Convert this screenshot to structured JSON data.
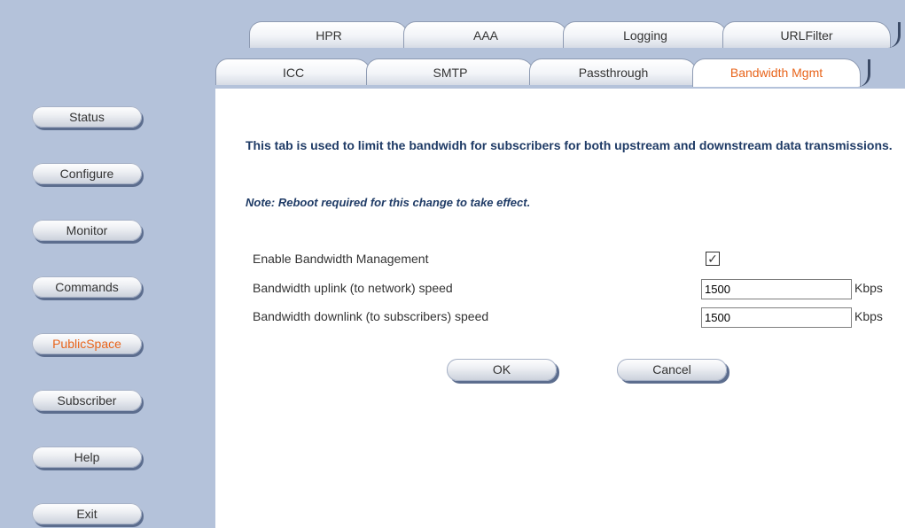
{
  "sidebar": {
    "items": [
      {
        "label": "Status"
      },
      {
        "label": "Configure"
      },
      {
        "label": "Monitor"
      },
      {
        "label": "Commands"
      },
      {
        "label": "PublicSpace"
      },
      {
        "label": "Subscriber"
      },
      {
        "label": "Help"
      },
      {
        "label": "Exit"
      }
    ],
    "active": "PublicSpace"
  },
  "tabs": {
    "row1": [
      {
        "label": "HPR"
      },
      {
        "label": "AAA"
      },
      {
        "label": "Logging"
      },
      {
        "label": "URLFilter"
      }
    ],
    "row2": [
      {
        "label": "ICC"
      },
      {
        "label": "SMTP"
      },
      {
        "label": "Passthrough"
      },
      {
        "label": "Bandwidth Mgmt"
      }
    ],
    "selected": "Bandwidth Mgmt"
  },
  "content": {
    "description": "This tab is used to limit the bandwidh for subscribers for both upstream and downstream data transmissions.",
    "note": "Note: Reboot required for this change to take effect.",
    "fields": {
      "enable": {
        "label": "Enable Bandwidth Management",
        "checked": true,
        "check_glyph": "✓"
      },
      "uplink": {
        "label": "Bandwidth uplink (to network) speed",
        "value": "1500",
        "unit": "Kbps"
      },
      "downlink": {
        "label": "Bandwidth downlink (to subscribers) speed",
        "value": "1500",
        "unit": "Kbps"
      }
    },
    "buttons": {
      "ok": "OK",
      "cancel": "Cancel"
    }
  },
  "colors": {
    "sidebar_bg": "#b4c2da",
    "accent": "#e8641b",
    "heading_text": "#1f3b66"
  }
}
